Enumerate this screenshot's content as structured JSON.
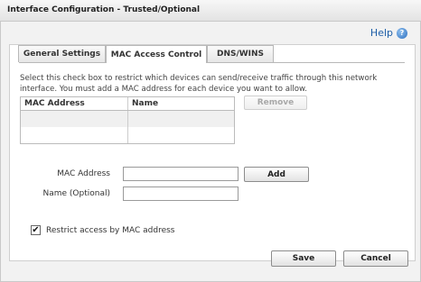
{
  "window": {
    "title": "Interface Configuration - Trusted/Optional"
  },
  "help": {
    "label": "Help",
    "icon": "question-icon"
  },
  "tabs": [
    {
      "label": "General Settings",
      "active": false
    },
    {
      "label": "MAC Access Control",
      "active": true
    },
    {
      "label": "DNS/WINS",
      "active": false
    }
  ],
  "mac_access": {
    "description": "Select this check box to restrict which devices can send/receive traffic through this network interface. You must add a MAC address for each device you want to allow.",
    "table": {
      "columns": [
        "MAC Address",
        "Name"
      ],
      "rows": []
    },
    "remove_label": "Remove",
    "mac_address_label": "MAC Address",
    "mac_address_value": "",
    "add_label": "Add",
    "name_label": "Name (Optional)",
    "name_value": "",
    "restrict_label": "Restrict access by MAC address",
    "restrict_checked": true
  },
  "footer": {
    "save_label": "Save",
    "cancel_label": "Cancel"
  }
}
